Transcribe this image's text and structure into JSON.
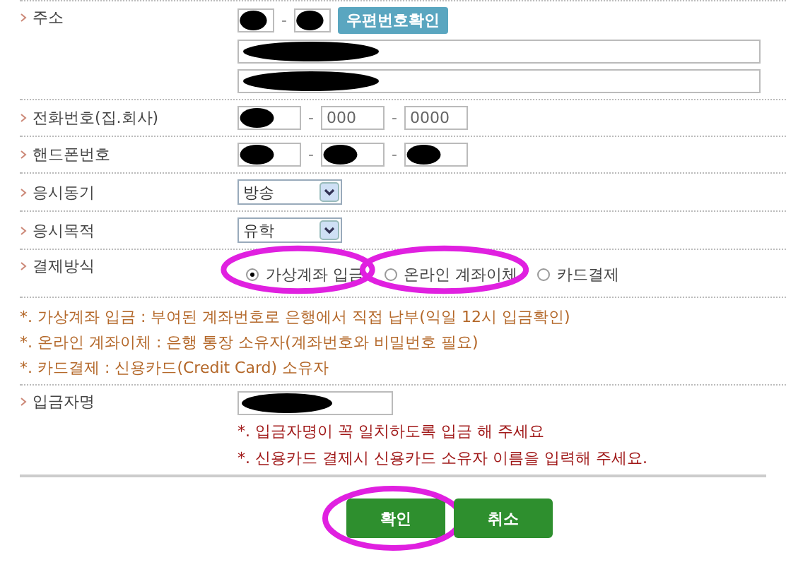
{
  "address": {
    "label": "주소",
    "separator": "-",
    "zip_button": "우편번호확인",
    "zip_fields": [
      {
        "redacted": true
      },
      {
        "redacted": true
      }
    ],
    "lines": [
      {
        "redacted": true
      },
      {
        "redacted": true
      }
    ]
  },
  "phone_rows": [
    {
      "label": "전화번호(집.회사)",
      "fields": [
        {
          "redacted": true
        },
        {
          "value": "000",
          "redacted": false
        },
        {
          "value": "0000",
          "redacted": false
        }
      ],
      "separators": [
        "-",
        "-"
      ]
    },
    {
      "label": "핸드폰번호",
      "fields": [
        {
          "redacted": true
        },
        {
          "redacted": true
        },
        {
          "redacted": true
        }
      ],
      "separators": [
        "-",
        "-"
      ]
    }
  ],
  "select_rows": [
    {
      "label": "응시동기",
      "value": "방송"
    },
    {
      "label": "응시목적",
      "value": "유학"
    }
  ],
  "payment": {
    "label": "결제방식",
    "options": [
      {
        "label": "가상계좌 입금",
        "selected": true,
        "circled": true
      },
      {
        "label": "온라인 계좌이체",
        "selected": false,
        "circled": true
      },
      {
        "label": "카드결제",
        "selected": false,
        "circled": false
      }
    ],
    "notes": [
      "*. 가상계좌 입금 : 부여된 계좌번호로 은행에서 직접 납부(익일 12시 입금확인)",
      "*. 온라인 계좌이체 : 은행 통장 소유자(계좌번호와 비밀번호 필요)",
      "*. 카드결제 : 신용카드(Credit Card) 소유자"
    ]
  },
  "depositor": {
    "label": "입금자명",
    "redacted": true,
    "notes": [
      "*. 입금자명이 꼭 일치하도록 입금 해 주세요",
      "*. 신용카드 결제시 신용카드 소유자 이름을 입력해 주세요."
    ]
  },
  "buttons": [
    {
      "label": "확인",
      "circled": true
    },
    {
      "label": "취소",
      "circled": false
    }
  ]
}
